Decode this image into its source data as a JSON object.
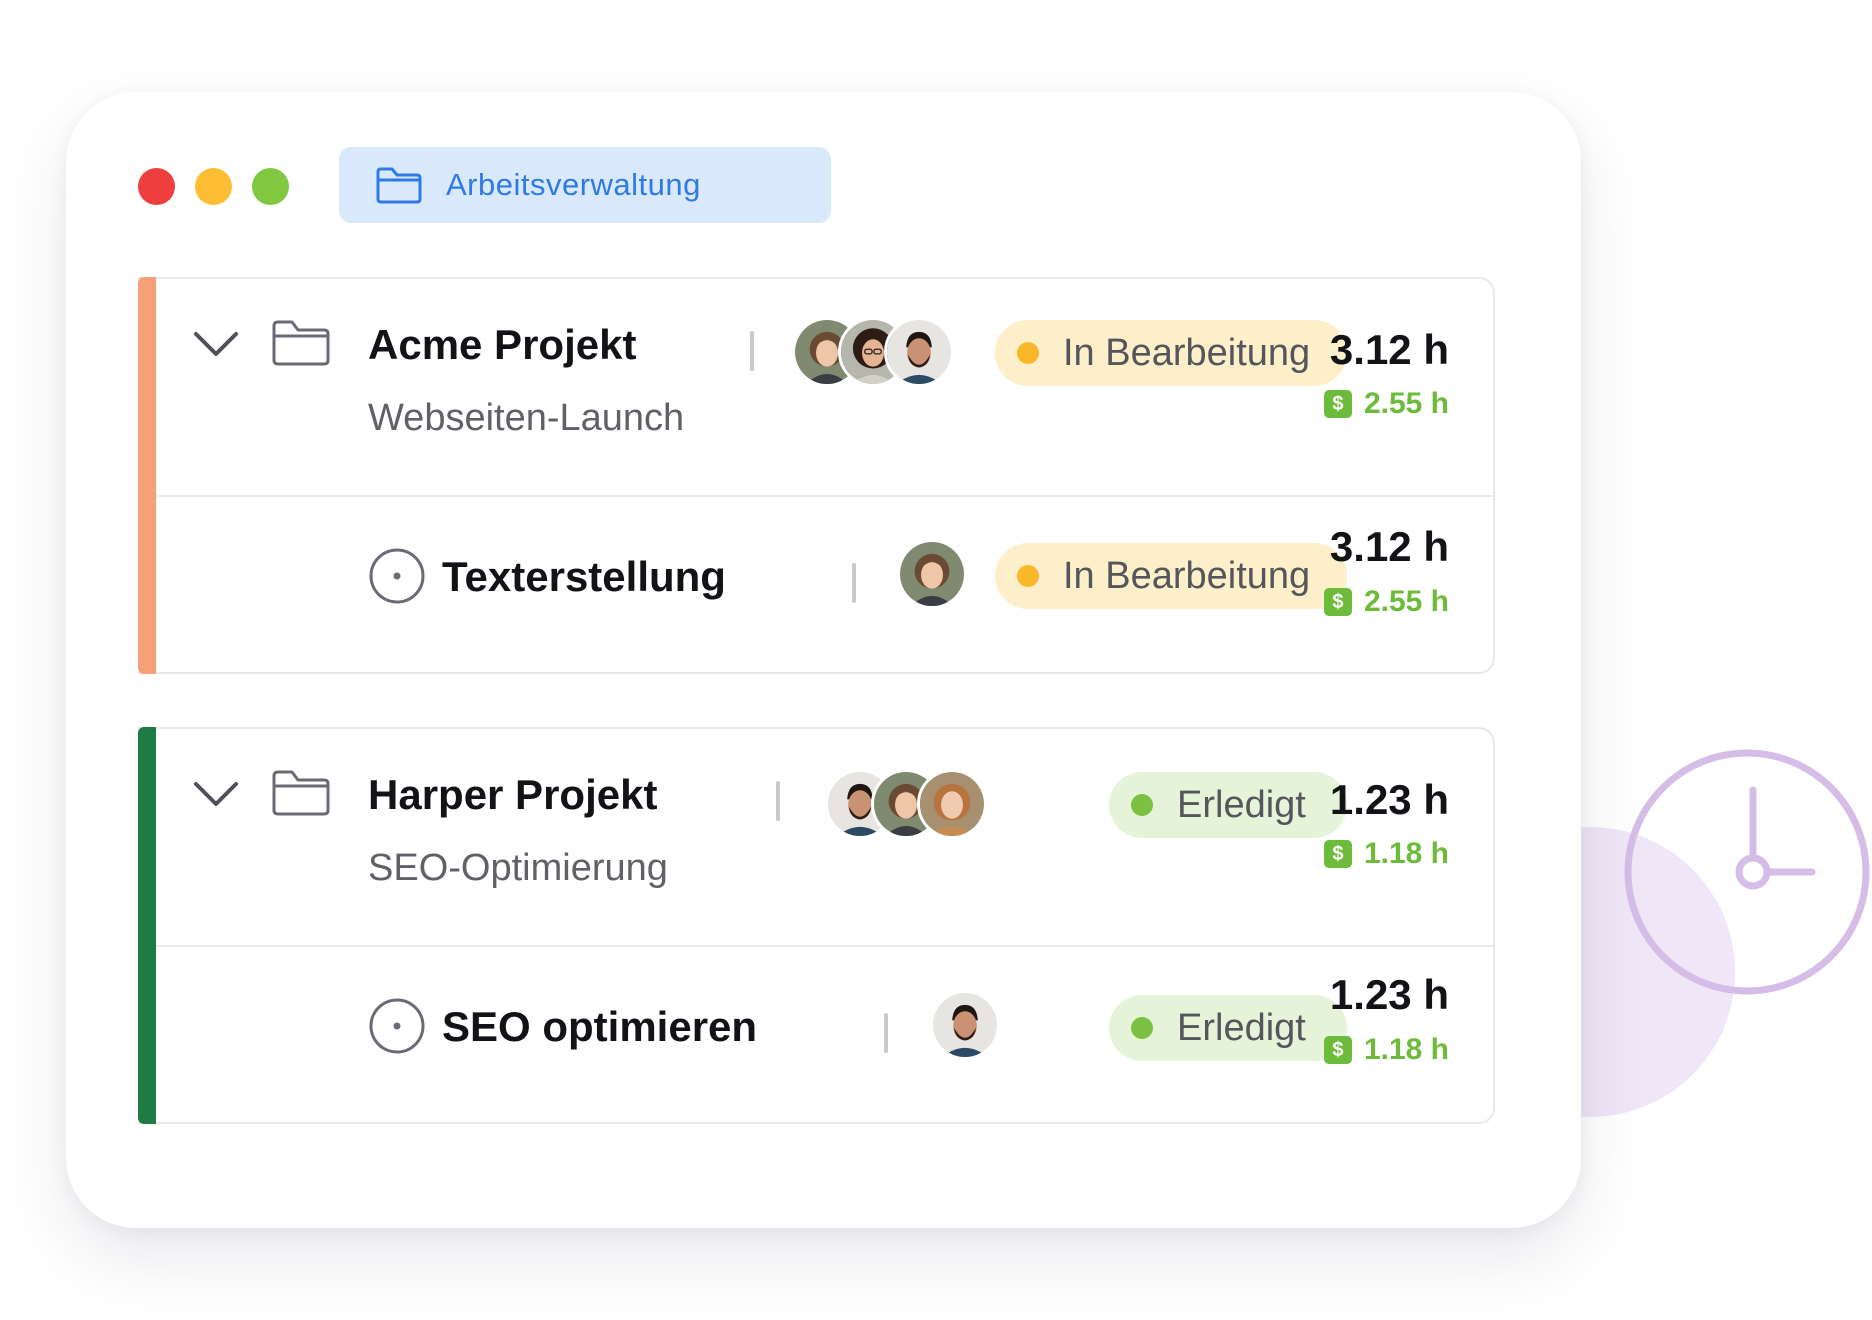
{
  "colors": {
    "window_dot_red": "#ee3f3e",
    "window_dot_yellow": "#fdbe33",
    "window_dot_green": "#7fc840",
    "tab_bg": "#d9e8fb",
    "tab_text": "#2f7be6",
    "accent_acme": "#f5a079",
    "accent_harper": "#1f7a44",
    "status_in_progress": "#fbb72a",
    "status_done": "#7cc242",
    "billable": "#6dbb3a",
    "clock_icon": "#d5bde8"
  },
  "workspace_tab": {
    "icon": "folder-icon",
    "label": "Arbeitsverwaltung"
  },
  "projects": [
    {
      "title": "Acme Projekt",
      "subtitle": "Webseiten-Launch",
      "avatars": [
        "avatar-woman-1",
        "avatar-woman-2",
        "avatar-man-1"
      ],
      "status": "In Bearbeitung",
      "time": "3.12 h",
      "billable_icon": "$",
      "billable": "2.55 h",
      "task": {
        "title": "Texterstellung",
        "avatars": [
          "avatar-woman-1"
        ],
        "status": "In Bearbeitung",
        "time": "3.12 h",
        "billable_icon": "$",
        "billable": "2.55 h"
      }
    },
    {
      "title": "Harper Projekt",
      "subtitle": "SEO-Optimierung",
      "avatars": [
        "avatar-man-1",
        "avatar-woman-1",
        "avatar-woman-3"
      ],
      "status": "Erledigt",
      "time": "1.23 h",
      "billable_icon": "$",
      "billable": "1.18 h",
      "task": {
        "title": "SEO optimieren",
        "avatars": [
          "avatar-man-1"
        ],
        "status": "Erledigt",
        "time": "1.23 h",
        "billable_icon": "$",
        "billable": "1.18 h"
      }
    }
  ]
}
